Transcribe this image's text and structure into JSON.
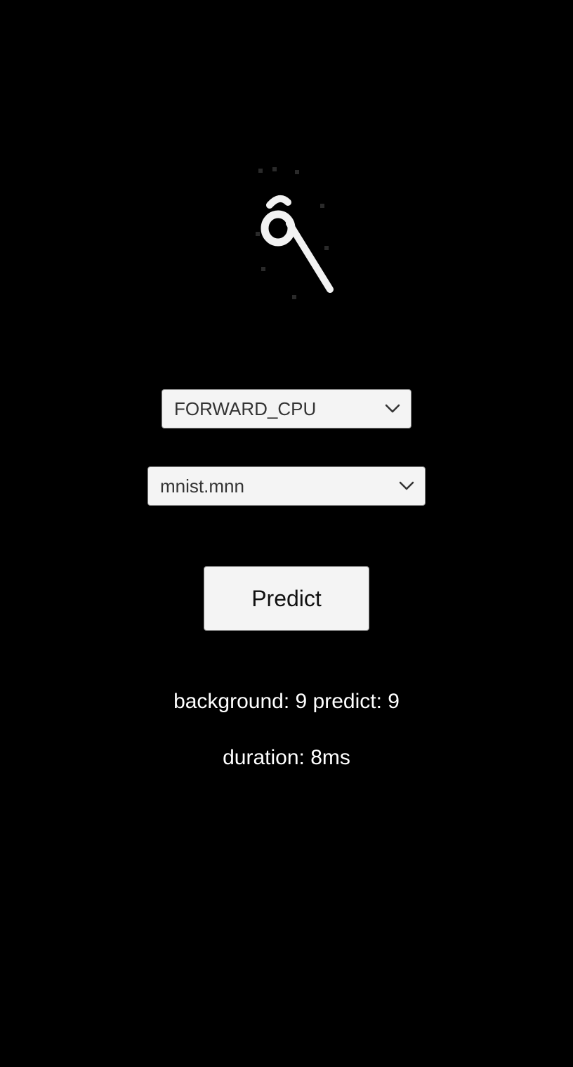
{
  "image": {
    "icon": "handwritten-digit-image"
  },
  "backend_select": {
    "value": "FORWARD_CPU",
    "icon": "chevron-down-icon"
  },
  "model_select": {
    "value": "mnist.mnn",
    "icon": "chevron-down-icon"
  },
  "predict_button": {
    "label": "Predict"
  },
  "result": {
    "prediction_text": "background: 9 predict: 9",
    "duration_text": "duration: 8ms"
  },
  "colors": {
    "background": "#000000",
    "text": "#ffffff",
    "control_bg": "#f4f4f4",
    "control_border": "#8a8a8a"
  }
}
